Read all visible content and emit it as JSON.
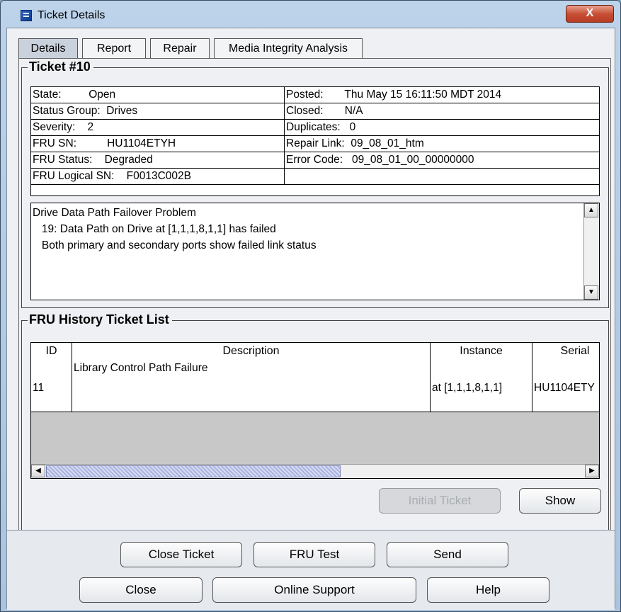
{
  "window": {
    "title": "Ticket Details",
    "close_glyph": "X"
  },
  "tabs": [
    {
      "label": "Details",
      "active": true
    },
    {
      "label": "Report",
      "active": false
    },
    {
      "label": "Repair",
      "active": false
    },
    {
      "label": "Media Integrity Analysis",
      "active": false
    }
  ],
  "ticket": {
    "title": "Ticket #10",
    "rows": [
      {
        "left": "State:         Open",
        "right": "Posted:       Thu May 15 16:11:50 MDT 2014"
      },
      {
        "left": "Status Group:  Drives",
        "right": "Closed:       N/A"
      },
      {
        "left": "Severity:    2",
        "right": "Duplicates:   0"
      },
      {
        "left": "FRU SN:          HU1104ETYH",
        "right": "Repair Link:  09_08_01_htm"
      },
      {
        "left": "FRU Status:    Degraded",
        "right": "Error Code:   09_08_01_00_00000000"
      },
      {
        "left": "FRU Logical SN:    F0013C002B",
        "right": ""
      }
    ],
    "description": "Drive Data Path Failover Problem\n   19: Data Path on Drive at [1,1,1,8,1,1] has failed\n   Both primary and secondary ports show failed link status"
  },
  "history": {
    "title": "FRU History Ticket List",
    "columns": [
      "ID",
      "Description",
      "Instance",
      "Serial"
    ],
    "rows": [
      {
        "id": "11",
        "description": "Library Control Path Failure",
        "instance": "at [1,1,1,8,1,1]",
        "serial": "HU1104ETY"
      }
    ],
    "scroll_left": "◀",
    "scroll_right": "▶"
  },
  "scroll": {
    "up": "▲",
    "down": "▼"
  },
  "buttons": {
    "initial_ticket": "Initial Ticket",
    "show": "Show",
    "close_ticket": "Close Ticket",
    "fru_test": "FRU Test",
    "send": "Send",
    "close": "Close",
    "online_support": "Online Support",
    "help": "Help"
  }
}
